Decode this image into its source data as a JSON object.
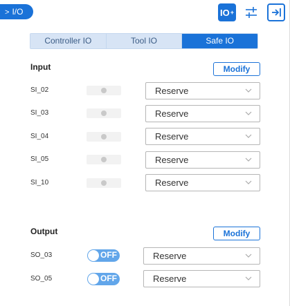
{
  "header": {
    "title": "I/O",
    "io_button": "IO"
  },
  "tabs": [
    {
      "label": "Controller IO",
      "active": false
    },
    {
      "label": "Tool IO",
      "active": false
    },
    {
      "label": "Safe IO",
      "active": true
    }
  ],
  "input": {
    "title": "Input",
    "modify_label": "Modify",
    "rows": [
      {
        "name": "SI_02",
        "value": "Reserve"
      },
      {
        "name": "SI_03",
        "value": "Reserve"
      },
      {
        "name": "SI_04",
        "value": "Reserve"
      },
      {
        "name": "SI_05",
        "value": "Reserve"
      },
      {
        "name": "SI_10",
        "value": "Reserve"
      }
    ]
  },
  "output": {
    "title": "Output",
    "modify_label": "Modify",
    "rows": [
      {
        "name": "SO_03",
        "state": "OFF",
        "value": "Reserve"
      },
      {
        "name": "SO_05",
        "state": "OFF",
        "value": "Reserve"
      }
    ]
  },
  "colors": {
    "accent": "#1a72d8",
    "tab_inactive": "#d7e4f5",
    "toggle_off": "#62a6ea",
    "led_off": "#c9c9c9"
  },
  "icons": {
    "back": "chevron-right-icon",
    "io": "io-plus-icon",
    "adjust": "sliders-icon",
    "exit": "exit-icon",
    "dropdown": "chevron-down-icon"
  }
}
